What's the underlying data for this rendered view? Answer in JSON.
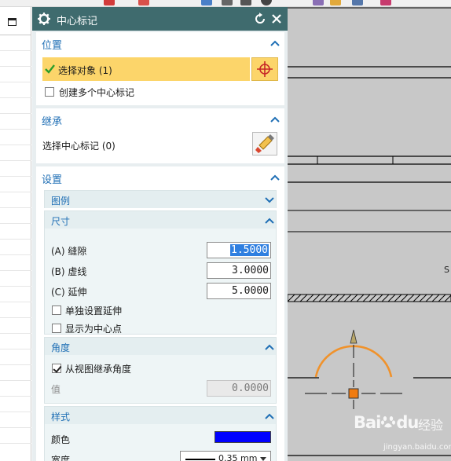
{
  "dialog": {
    "title": "中心标记",
    "position": {
      "heading": "位置",
      "select_object": "选择对象 (1)",
      "create_multiple": "创建多个中心标记"
    },
    "inherit": {
      "heading": "继承",
      "select_center_mark": "选择中心标记 (0)"
    },
    "settings": {
      "heading": "设置",
      "legend": {
        "heading": "图例"
      },
      "size": {
        "heading": "尺寸",
        "gap_label": "(A) 缝隙",
        "gap_value": "1.5000",
        "dash_label": "(B) 虚线",
        "dash_value": "3.0000",
        "extension_label": "(C) 延伸",
        "extension_value": "5.0000",
        "individual_extension": "单独设置延伸",
        "show_as_center_point": "显示为中心点"
      },
      "angle": {
        "heading": "角度",
        "inherit_from_view": "从视图继承角度",
        "value_label": "值",
        "value": "0.0000"
      },
      "style": {
        "heading": "样式",
        "color_label": "颜色",
        "color": "#0000ff",
        "width_label": "宽度",
        "width_value": "0.35 mm"
      }
    }
  },
  "graphics": {
    "side_label": "S"
  },
  "watermark": {
    "brand": "Bai",
    "brand_suffix": "du",
    "cn": "经验",
    "url": "jingyan.baidu.com"
  },
  "colors": {
    "titlebar": "#3f6b6e",
    "highlight": "#fcd56a",
    "section_heading": "#1f6fb5",
    "arc": "#f0922b"
  }
}
